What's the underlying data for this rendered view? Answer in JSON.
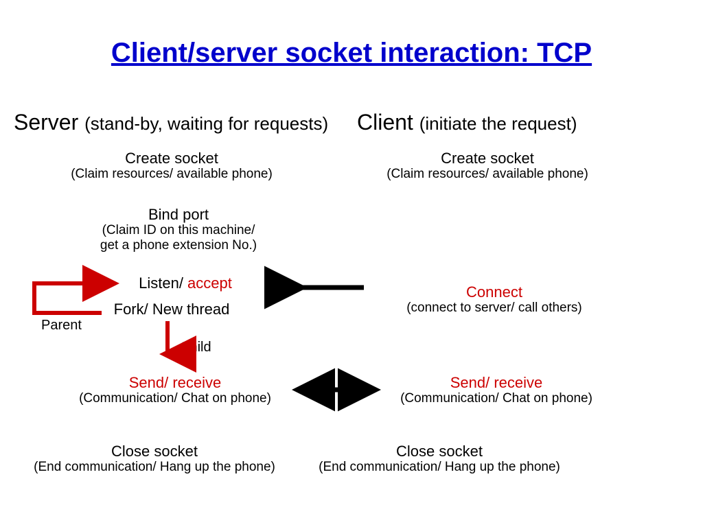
{
  "title": "Client/server socket interaction: TCP",
  "server": {
    "heading_main": "Server ",
    "heading_sub": "(stand-by, waiting for requests)",
    "create_main": "Create socket",
    "create_sub": "(Claim resources/ available phone)",
    "bind_main": "Bind port",
    "bind_sub1": "(Claim ID on this machine/",
    "bind_sub2": "get a phone extension No.)",
    "listen_a": "Listen/ ",
    "listen_b": "accept",
    "fork": "Fork/ New thread",
    "parent": "Parent",
    "child": "Child",
    "sr_main": "Send/ receive",
    "sr_sub": "(Communication/ Chat on phone)",
    "close_main": "Close socket",
    "close_sub": "(End communication/ Hang up the phone)"
  },
  "client": {
    "heading_main": "Client ",
    "heading_sub": "(initiate the request)",
    "create_main": "Create socket",
    "create_sub": "(Claim resources/ available phone)",
    "connect_main": "Connect",
    "connect_sub": "(connect to server/ call others)",
    "sr_main": "Send/ receive",
    "sr_sub": "(Communication/ Chat on phone)",
    "close_main": "Close socket",
    "close_sub": "(End communication/ Hang up the phone)"
  }
}
